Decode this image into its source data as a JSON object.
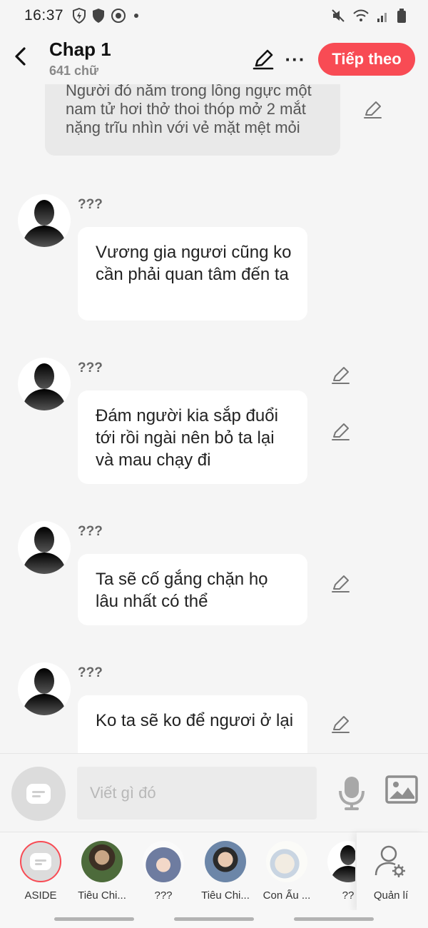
{
  "status_bar": {
    "time": "16:37",
    "left_icons": [
      "shield-bolt-icon",
      "shield-icon",
      "gear-circle-icon",
      "dot-icon"
    ],
    "right_icons": [
      "mute-icon",
      "wifi-icon",
      "signal-icon",
      "battery-icon"
    ]
  },
  "header": {
    "back_icon": "back-chevron-icon",
    "title": "Chap 1",
    "subtitle": "641 chữ",
    "edit_icon": "pencil-icon",
    "more_label": "···",
    "next_label": "Tiếp theo",
    "accent": "#f84b54"
  },
  "narration": {
    "text": "Người đó nằm trong lồng ngực một nam tử hơi thở thoi thóp mở 2 mắt nặng trĩu nhìn với vẻ mặt mệt mỏi"
  },
  "messages": [
    {
      "sender": "???",
      "text": "Vương gia ngươi cũng ko cần phải quan tâm đến ta"
    },
    {
      "sender": "???",
      "text": "Đám người kia sắp đuổi tới rồi ngài nên bỏ ta lại và mau chạy đi"
    },
    {
      "sender": "???",
      "text": "Ta sẽ cố gắng chặn họ lâu nhất có thể"
    },
    {
      "sender": "???",
      "text": "Ko ta sẽ ko để ngươi ở lại"
    }
  ],
  "input": {
    "placeholder": "Viết gì đó",
    "value": "",
    "mic_icon": "microphone-icon",
    "image_icon": "image-icon"
  },
  "characters": [
    {
      "name": "ASIDE",
      "icon": "aside-icon"
    },
    {
      "name": "Tiêu Chi..."
    },
    {
      "name": "???"
    },
    {
      "name": "Tiêu Chi..."
    },
    {
      "name": "Con Ẩu ..."
    },
    {
      "name": "??"
    },
    {
      "name": "Quản lí",
      "icon": "user-gear-icon"
    }
  ]
}
